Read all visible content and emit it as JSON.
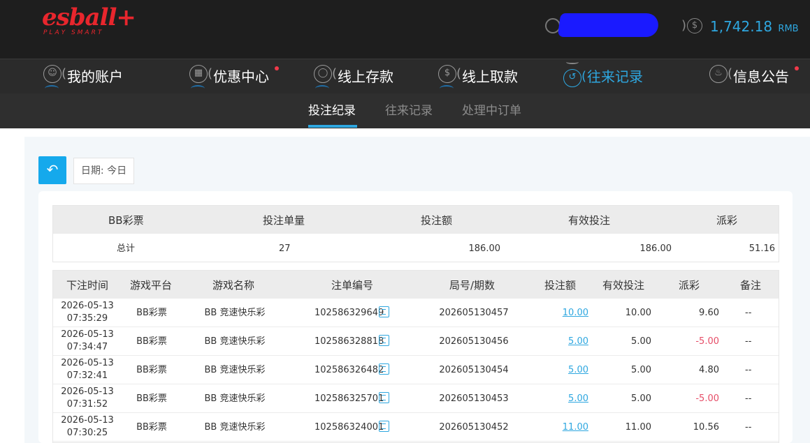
{
  "header": {
    "logo_main": "esball+",
    "logo_sub": "PLAY SMART",
    "balance_amount": "1,742.18",
    "balance_currency": "RMB",
    "icons": {
      "user": "user-circle-icon",
      "coin": "dollar-coin-icon"
    }
  },
  "mainnav": {
    "items": [
      {
        "label": "我的账户",
        "icon": "user-circle-icon",
        "active": false,
        "dot": false
      },
      {
        "label": "优惠中心",
        "icon": "gift-icon",
        "active": false,
        "dot": true
      },
      {
        "label": "线上存款",
        "icon": "deposit-icon",
        "active": false,
        "dot": false
      },
      {
        "label": "线上取款",
        "icon": "withdraw-icon",
        "active": false,
        "dot": false
      },
      {
        "label": "往来记录",
        "icon": "records-icon",
        "active": true,
        "dot": false
      },
      {
        "label": "信息公告",
        "icon": "bell-icon",
        "active": false,
        "dot": true
      }
    ]
  },
  "subnav": {
    "tabs": [
      {
        "label": "投注纪录",
        "active": true
      },
      {
        "label": "往来记录",
        "active": false
      },
      {
        "label": "处理中订单",
        "active": false
      }
    ]
  },
  "filter": {
    "back_icon": "back-arrow-icon",
    "date_label": "日期: 今日"
  },
  "summary": {
    "headers": [
      "BB彩票",
      "投注单量",
      "投注额",
      "有效投注",
      "派彩"
    ],
    "row": [
      "总计",
      "27",
      "186.00",
      "186.00",
      "51.16"
    ]
  },
  "detail": {
    "headers": [
      "下注时间",
      "游戏平台",
      "游戏名称",
      "注单编号",
      "局号/期数",
      "投注额",
      "有效投注",
      "派彩",
      "备注"
    ],
    "rows": [
      {
        "date": "2026-05-13",
        "time": "07:35:29",
        "platform": "BB彩票",
        "game": "BB 竞速快乐彩",
        "order": "102586329649",
        "period": "202605130457",
        "bet": "10.00",
        "valid": "10.00",
        "payout": "9.60",
        "note": "--"
      },
      {
        "date": "2026-05-13",
        "time": "07:34:47",
        "platform": "BB彩票",
        "game": "BB 竞速快乐彩",
        "order": "102586328818",
        "period": "202605130456",
        "bet": "5.00",
        "valid": "5.00",
        "payout": "-5.00",
        "note": "--"
      },
      {
        "date": "2026-05-13",
        "time": "07:32:41",
        "platform": "BB彩票",
        "game": "BB 竞速快乐彩",
        "order": "102586326482",
        "period": "202605130454",
        "bet": "5.00",
        "valid": "5.00",
        "payout": "4.80",
        "note": "--"
      },
      {
        "date": "2026-05-13",
        "time": "07:31:52",
        "platform": "BB彩票",
        "game": "BB 竞速快乐彩",
        "order": "102586325701",
        "period": "202605130453",
        "bet": "5.00",
        "valid": "5.00",
        "payout": "-5.00",
        "note": "--"
      },
      {
        "date": "2026-05-13",
        "time": "07:30:25",
        "platform": "BB彩票",
        "game": "BB 竞速快乐彩",
        "order": "102586324001",
        "period": "202605130452",
        "bet": "11.00",
        "valid": "11.00",
        "payout": "10.56",
        "note": "--"
      }
    ]
  },
  "colors": {
    "accent": "#2ea7e0",
    "negative": "#e64d67",
    "brand": "#e8262d",
    "notify_dot": "#f03a4a"
  }
}
